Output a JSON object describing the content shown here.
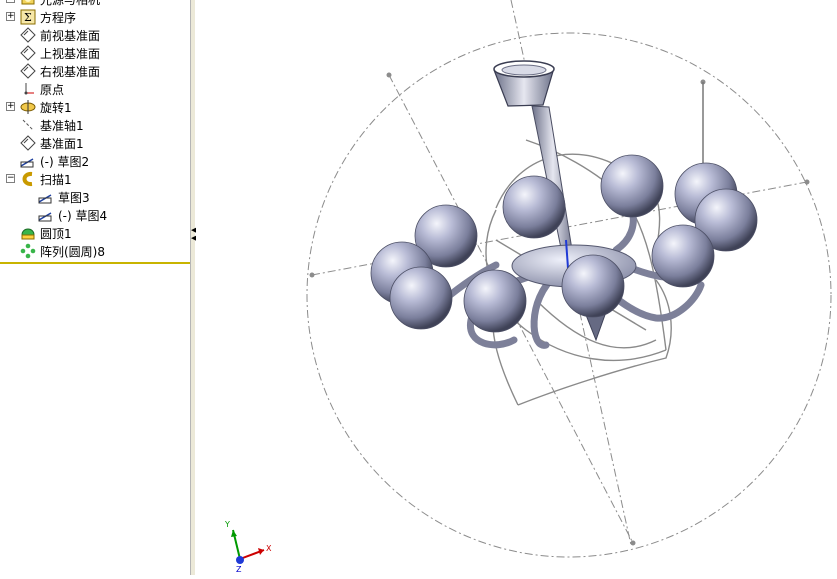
{
  "feature_tree": {
    "items": [
      {
        "label": "光源与相机",
        "icon": "lights-cameras-icon",
        "expandable": true
      },
      {
        "label": "方程序",
        "icon": "equations-icon",
        "expandable": true
      },
      {
        "label": "前视基准面",
        "icon": "plane-icon",
        "expandable": false
      },
      {
        "label": "上视基准面",
        "icon": "plane-icon",
        "expandable": false
      },
      {
        "label": "右视基准面",
        "icon": "plane-icon",
        "expandable": false
      },
      {
        "label": "原点",
        "icon": "origin-icon",
        "expandable": false
      },
      {
        "label": "旋转1",
        "icon": "revolve-icon",
        "expandable": true
      },
      {
        "label": "基准轴1",
        "icon": "axis-icon",
        "expandable": false
      },
      {
        "label": "基准面1",
        "icon": "plane-icon",
        "expandable": false
      },
      {
        "label": "(-)  草图2",
        "icon": "sketch-icon",
        "expandable": false
      },
      {
        "label": "扫描1",
        "icon": "sweep-icon",
        "expandable": true,
        "expanded": true
      },
      {
        "label": "草图3",
        "icon": "sketch-icon",
        "expandable": false
      },
      {
        "label": "(-)  草图4",
        "icon": "sketch-icon",
        "expandable": false
      },
      {
        "label": "圆顶1",
        "icon": "dome-icon",
        "expandable": false
      },
      {
        "label": "阵列(圆周)8",
        "icon": "circular-pattern-icon",
        "expandable": false
      }
    ]
  },
  "triad": {
    "x_label": "X",
    "y_label": "Y",
    "z_label": "Z"
  },
  "colors": {
    "sphere": "#a9adc8",
    "rollback_bar": "#c8b400",
    "construction": "#8c8c8c",
    "axis_x": "#cc0000",
    "axis_y": "#009900",
    "axis_z": "#0000cc"
  }
}
